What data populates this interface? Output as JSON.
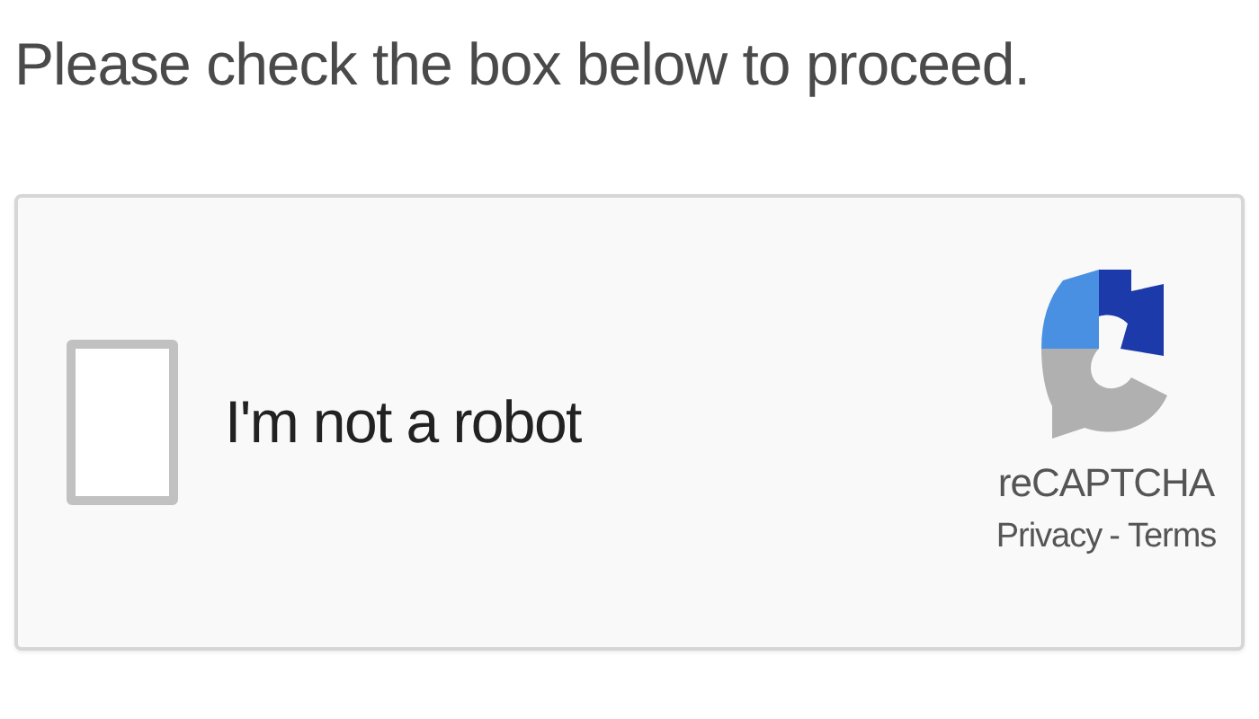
{
  "instruction": "Please check the box below to proceed.",
  "captcha": {
    "checkbox": {
      "label": "I'm not a robot",
      "checked": false
    },
    "brand": "reCAPTCHA",
    "links": [
      {
        "label": "Privacy"
      },
      {
        "label": "Terms"
      }
    ],
    "separator": "-"
  }
}
